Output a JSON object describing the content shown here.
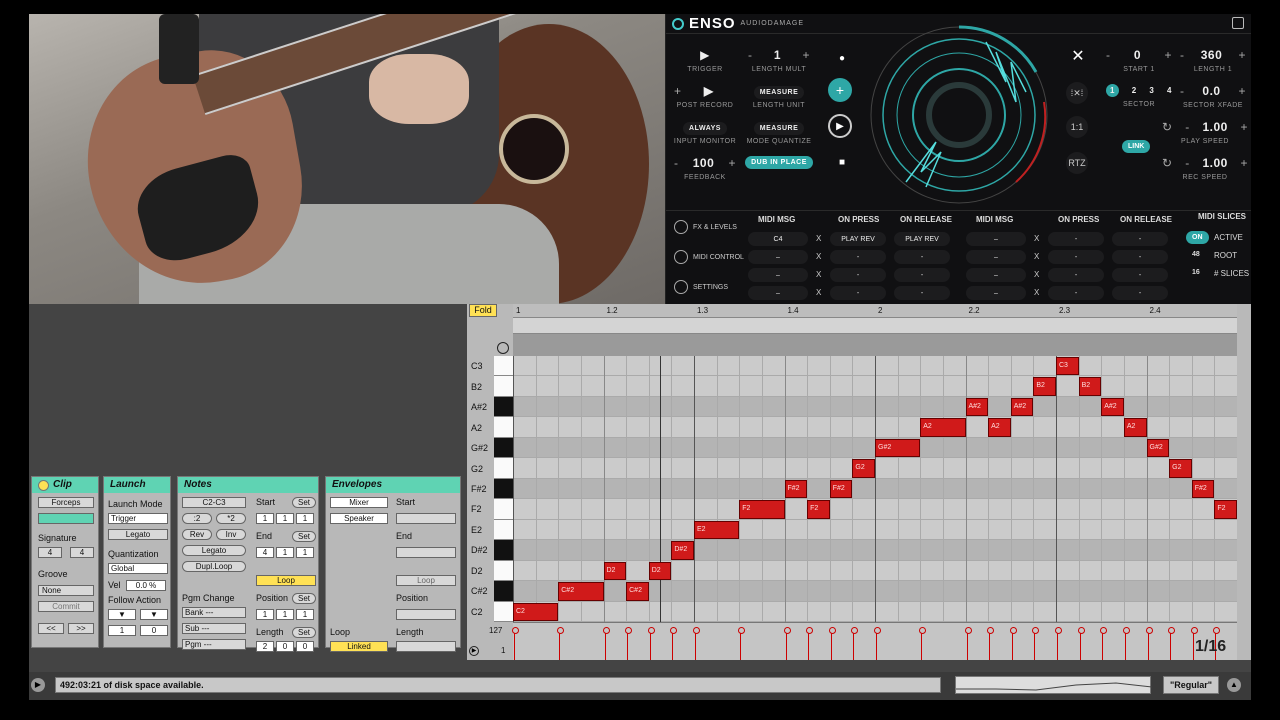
{
  "enso": {
    "logo": "ENSO",
    "brand": "AUDIODAMAGE",
    "trigger_label": "TRIGGER",
    "length_mult_label": "LENGTH MULT",
    "length_mult_value": "1",
    "post_record_label": "POST RECORD",
    "measure_1": "MEASURE",
    "length_unit_label": "LENGTH UNIT",
    "always": "ALWAYS",
    "input_monitor_label": "INPUT MONITOR",
    "measure_2": "MEASURE",
    "mode_quantize_label": "MODE QUANTIZE",
    "feedback_value": "100",
    "feedback_label": "FEEDBACK",
    "dub_in_place": "DUB IN PLACE",
    "start1_value": "0",
    "start1_label": "START 1",
    "length1_value": "360",
    "length1_label": "LENGTH 1",
    "sector_label": "SECTOR",
    "sector_nums": [
      "1",
      "2",
      "3",
      "4"
    ],
    "sector_xfade_value": "0.0",
    "sector_xfade_label": "SECTOR XFADE",
    "ratio_label": "1:1",
    "link_label": "LINK",
    "play_speed_value": "1.00",
    "play_speed_label": "PLAY SPEED",
    "rtz_label": "RTZ",
    "rec_speed_value": "1.00",
    "rec_speed_label": "REC SPEED",
    "tabs": [
      "FX & LEVELS",
      "MIDI CONTROL",
      "SETTINGS"
    ],
    "midi_headers": [
      "MIDI MSG",
      "ON PRESS",
      "ON RELEASE",
      "MIDI MSG",
      "ON PRESS",
      "ON RELEASE"
    ],
    "midi_rows_left": [
      [
        "C4",
        "PLAY REV",
        "PLAY REV"
      ],
      [
        "–",
        "-",
        "-"
      ],
      [
        "–",
        "-",
        "-"
      ],
      [
        "–",
        "-",
        "-"
      ]
    ],
    "midi_rows_right": [
      [
        "–",
        "-",
        "-"
      ],
      [
        "–",
        "-",
        "-"
      ],
      [
        "–",
        "-",
        "-"
      ],
      [
        "–",
        "-",
        "-"
      ]
    ],
    "midi_slices_title": "MIDI SLICES",
    "on_label": "ON",
    "active_label": "ACTIVE",
    "root_value": "48",
    "root_label": "ROOT",
    "slices_value": "16",
    "slices_label": "# SLICES"
  },
  "clip": {
    "title": "Clip",
    "name": "Forceps",
    "signature_label": "Signature",
    "sig_num": "4",
    "sig_den": "4",
    "groove_label": "Groove",
    "groove_value": "None",
    "commit": "Commit"
  },
  "launch": {
    "title": "Launch",
    "mode_label": "Launch Mode",
    "mode_value": "Trigger",
    "legato": "Legato",
    "quant_label": "Quantization",
    "quant_value": "Global",
    "vel_label": "Vel",
    "vel_value": "0.0 %",
    "follow_label": "Follow Action",
    "fa1": "1",
    "fa2": "0",
    "fa3": "1",
    "fa4": "0"
  },
  "notes": {
    "title": "Notes",
    "range": "C2-C3",
    "div2": ":2",
    "mul2": "*2",
    "rev": "Rev",
    "inv": "Inv",
    "legato": "Legato",
    "dupl": "Dupl.Loop",
    "pgm_label": "Pgm Change",
    "bank": "Bank ---",
    "sub": "Sub ---",
    "pgm": "Pgm ---",
    "start_label": "Start",
    "set": "Set",
    "start_vals": [
      "1",
      "1",
      "1"
    ],
    "end_label": "End",
    "end_vals": [
      "4",
      "1",
      "1"
    ],
    "loop": "Loop",
    "pos_label": "Position",
    "pos_vals": [
      "1",
      "1",
      "1"
    ],
    "len_label": "Length",
    "len_vals": [
      "2",
      "0",
      "0"
    ]
  },
  "envelopes": {
    "title": "Envelopes",
    "mixer": "Mixer",
    "speaker": "Speaker",
    "start_label": "Start",
    "end_label": "End",
    "loop": "Loop",
    "pos_label": "Position",
    "len_label": "Length",
    "loop_label": "Loop",
    "linked": "Linked"
  },
  "roll": {
    "fold": "Fold",
    "ruler": [
      "1",
      "1.2",
      "1.3",
      "1.4",
      "2",
      "2.2",
      "2.3",
      "2.4"
    ],
    "keys": [
      "C3",
      "B2",
      "A#2",
      "A2",
      "G#2",
      "G2",
      "F#2",
      "F2",
      "E2",
      "D#2",
      "D2",
      "C#2",
      "C2"
    ],
    "notes": [
      {
        "label": "C2",
        "row": 12,
        "start": 0,
        "len": 2
      },
      {
        "label": "C#2",
        "row": 11,
        "start": 2,
        "len": 2
      },
      {
        "label": "D2",
        "row": 10,
        "start": 4,
        "len": 1
      },
      {
        "label": "C#2",
        "row": 11,
        "start": 5,
        "len": 1
      },
      {
        "label": "D2",
        "row": 10,
        "start": 6,
        "len": 1
      },
      {
        "label": "D#2",
        "row": 9,
        "start": 7,
        "len": 1
      },
      {
        "label": "E2",
        "row": 8,
        "start": 8,
        "len": 2
      },
      {
        "label": "F2",
        "row": 7,
        "start": 10,
        "len": 2
      },
      {
        "label": "F#2",
        "row": 6,
        "start": 12,
        "len": 1
      },
      {
        "label": "F2",
        "row": 7,
        "start": 13,
        "len": 1
      },
      {
        "label": "F#2",
        "row": 6,
        "start": 14,
        "len": 1
      },
      {
        "label": "G2",
        "row": 5,
        "start": 15,
        "len": 1
      },
      {
        "label": "G#2",
        "row": 4,
        "start": 16,
        "len": 2
      },
      {
        "label": "A2",
        "row": 3,
        "start": 18,
        "len": 2
      },
      {
        "label": "A#2",
        "row": 2,
        "start": 20,
        "len": 1
      },
      {
        "label": "A2",
        "row": 3,
        "start": 21,
        "len": 1
      },
      {
        "label": "A#2",
        "row": 2,
        "start": 22,
        "len": 1
      },
      {
        "label": "B2",
        "row": 1,
        "start": 23,
        "len": 1
      },
      {
        "label": "C3",
        "row": 0,
        "start": 24,
        "len": 1
      },
      {
        "label": "B2",
        "row": 1,
        "start": 25,
        "len": 1
      },
      {
        "label": "A#2",
        "row": 2,
        "start": 26,
        "len": 1
      },
      {
        "label": "A2",
        "row": 3,
        "start": 27,
        "len": 1
      },
      {
        "label": "G#2",
        "row": 4,
        "start": 28,
        "len": 1
      },
      {
        "label": "G2",
        "row": 5,
        "start": 29,
        "len": 1
      },
      {
        "label": "F#2",
        "row": 6,
        "start": 30,
        "len": 1
      },
      {
        "label": "F2",
        "row": 7,
        "start": 31,
        "len": 1
      }
    ],
    "vel_max": "127",
    "vel_min": "1",
    "grid": "1/16"
  },
  "status": {
    "message": "492:03:21 of disk space available.",
    "regular": "\"Regular\""
  }
}
